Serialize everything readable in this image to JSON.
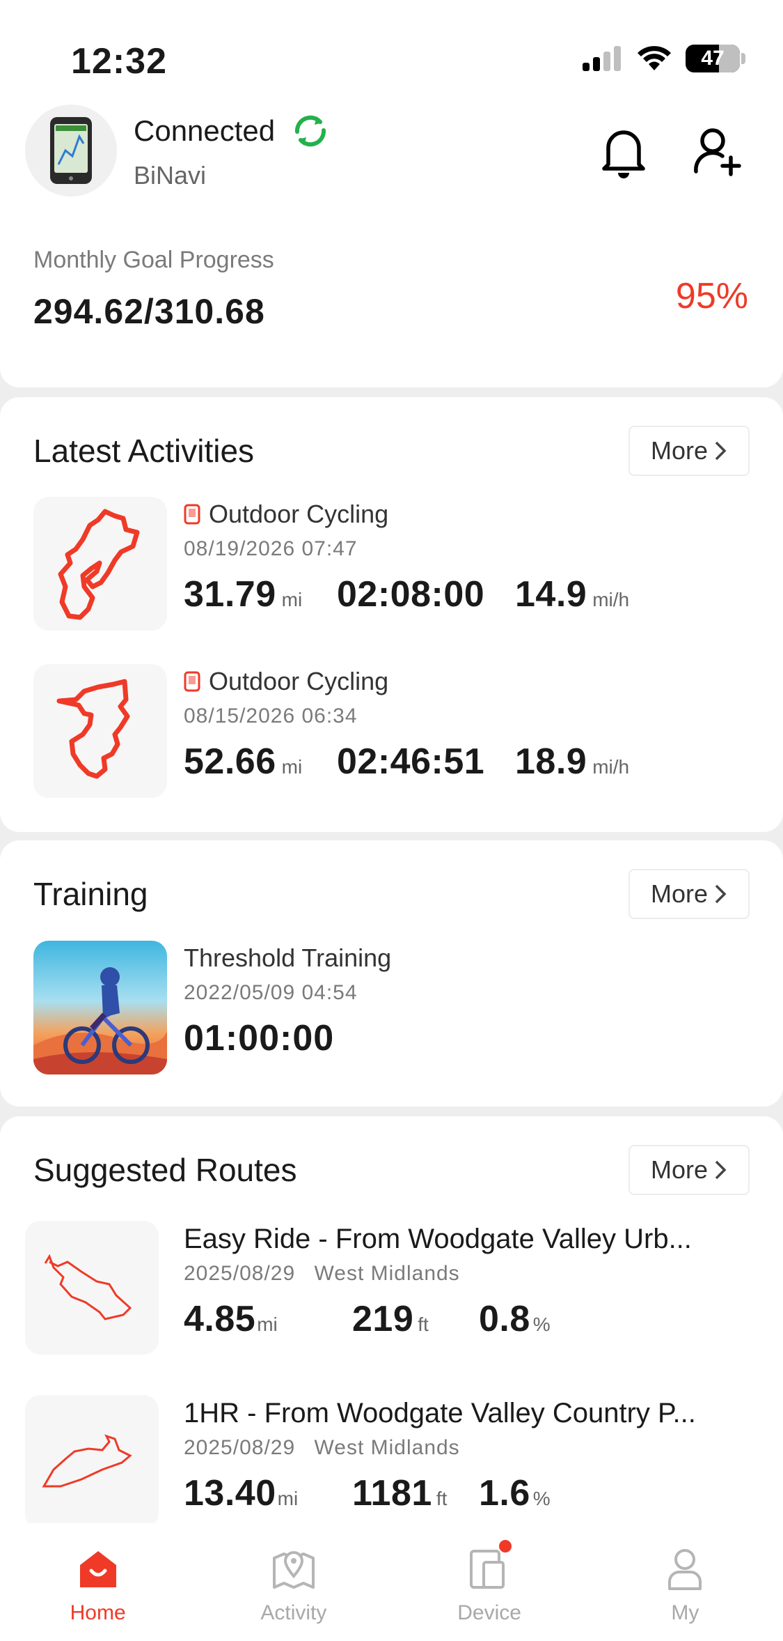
{
  "status_bar": {
    "time": "12:32",
    "battery": "47"
  },
  "device": {
    "status": "Connected",
    "name": "BiNavi"
  },
  "goal": {
    "label": "Monthly Goal Progress",
    "value": "294.62/310.68",
    "percent": "95%",
    "fraction": 0.948
  },
  "activities": {
    "title": "Latest Activities",
    "more": "More",
    "items": [
      {
        "type": "Outdoor Cycling",
        "date": "08/19/2026 07:47",
        "distance": "31.79",
        "distance_unit": "mi",
        "duration": "02:08:00",
        "speed": "14.9",
        "speed_unit": "mi/h"
      },
      {
        "type": "Outdoor Cycling",
        "date": "08/15/2026 06:34",
        "distance": "52.66",
        "distance_unit": "mi",
        "duration": "02:46:51",
        "speed": "18.9",
        "speed_unit": "mi/h"
      }
    ]
  },
  "training": {
    "title": "Training",
    "more": "More",
    "item": {
      "name": "Threshold Training",
      "date": "2022/05/09 04:54",
      "duration": "01:00:00"
    }
  },
  "routes": {
    "title": "Suggested Routes",
    "more": "More",
    "items": [
      {
        "name": "Easy Ride - From Woodgate Valley Urb...",
        "date": "2025/08/29",
        "region": "West Midlands",
        "distance": "4.85",
        "distance_unit": "mi",
        "elevation": "219",
        "elevation_unit": "ft",
        "grade": "0.8",
        "grade_unit": "%"
      },
      {
        "name": "1HR - From Woodgate Valley Country P...",
        "date": "2025/08/29",
        "region": "West Midlands",
        "distance": "13.40",
        "distance_unit": "mi",
        "elevation": "1181",
        "elevation_unit": "ft",
        "grade": "1.6",
        "grade_unit": "%"
      }
    ]
  },
  "tabs": [
    {
      "label": "Home",
      "icon": "home-icon",
      "active": true
    },
    {
      "label": "Activity",
      "icon": "map-pin-icon",
      "active": false
    },
    {
      "label": "Device",
      "icon": "device-icon",
      "active": false
    },
    {
      "label": "My",
      "icon": "person-icon",
      "active": false
    }
  ],
  "colors": {
    "accent": "#ef3a27",
    "connected": "#22b14c"
  }
}
